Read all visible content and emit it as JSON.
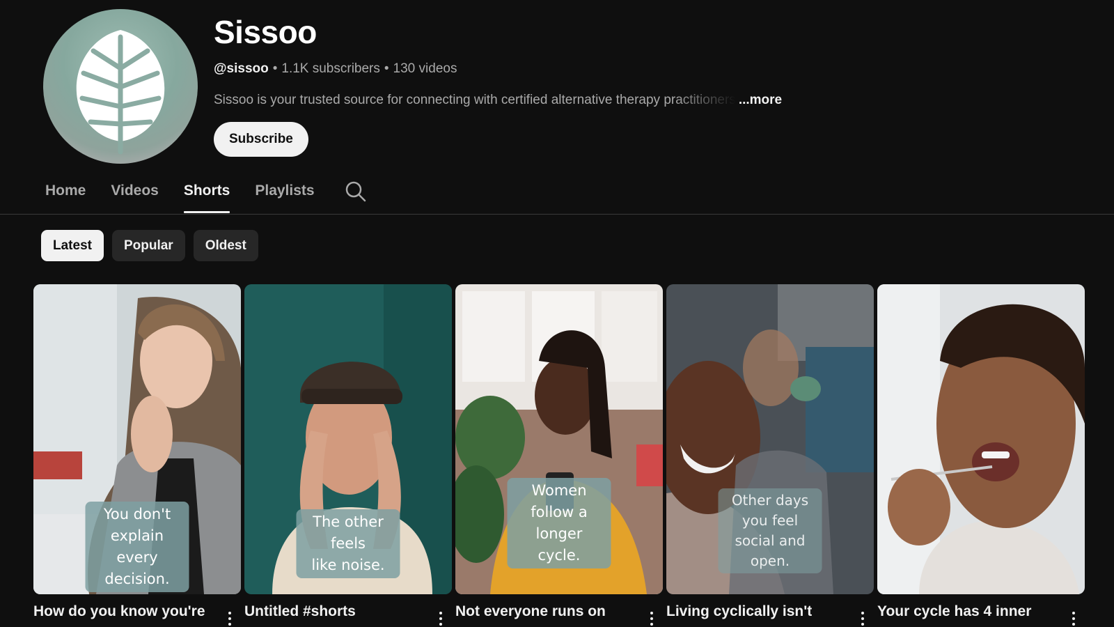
{
  "channel": {
    "name": "Sissoo",
    "handle": "@sissoo",
    "subscribers": "1.1K subscribers",
    "videos": "130 videos",
    "description": "Sissoo is your trusted source for connecting with certified alternative therapy practitioners",
    "more_label": "...more",
    "subscribe_label": "Subscribe",
    "avatar_icon": "leaf-logo-icon"
  },
  "tabs": [
    {
      "label": "Home",
      "active": false
    },
    {
      "label": "Videos",
      "active": false
    },
    {
      "label": "Shorts",
      "active": true
    },
    {
      "label": "Playlists",
      "active": false
    }
  ],
  "search_icon": "search-icon",
  "chips": [
    {
      "label": "Latest",
      "selected": true
    },
    {
      "label": "Popular",
      "selected": false
    },
    {
      "label": "Oldest",
      "selected": false
    }
  ],
  "shorts": [
    {
      "title": "How do you know you're",
      "caption": "You don't\nexplain\nevery decision."
    },
    {
      "title": "Untitled #shorts",
      "caption": "The other feels\nlike noise."
    },
    {
      "title": "Not everyone runs on",
      "caption": "Women follow a\nlonger cycle."
    },
    {
      "title": "Living cyclically isn't",
      "caption": "Other days you feel\nsocial and open."
    },
    {
      "title": "Your cycle has 4 inner",
      "caption": ""
    }
  ],
  "colors": {
    "background": "#0f0f0f",
    "text_primary": "#f1f1f1",
    "text_secondary": "#aaaaaa",
    "chip_bg": "#272727",
    "caption_bg": "#7ea0a2"
  }
}
